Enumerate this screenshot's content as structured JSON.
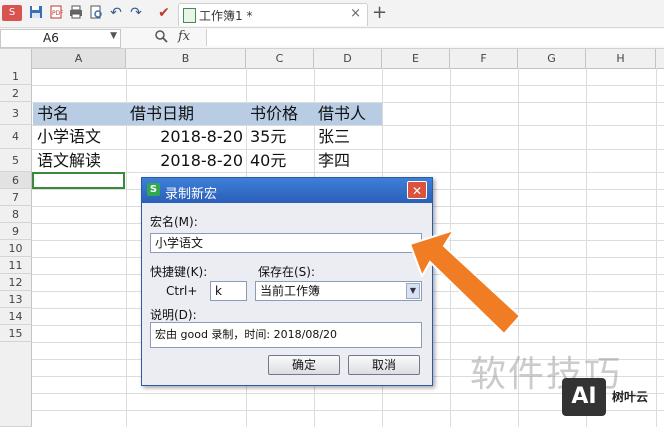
{
  "toolbar": {
    "app_menu_label": "S",
    "icons": [
      "folder-icon",
      "save-icon",
      "pdf-export-icon",
      "print-icon",
      "print-preview-icon",
      "undo-icon",
      "redo-icon",
      "format-painter-icon"
    ],
    "document_tab": {
      "title": "工作簿1 *",
      "close_label": "×"
    },
    "new_tab_label": "+"
  },
  "formula_bar": {
    "cell_reference": "A6",
    "fx_label": "fx",
    "formula_value": ""
  },
  "sheet": {
    "columns": [
      "A",
      "B",
      "C",
      "D",
      "E",
      "F",
      "G",
      "H"
    ],
    "rows": [
      "1",
      "2",
      "3",
      "4",
      "5",
      "6",
      "7",
      "8",
      "9",
      "10",
      "11",
      "12",
      "13",
      "14",
      "15"
    ],
    "header_row": [
      "书名",
      "借书日期",
      "书价格",
      "借书人"
    ],
    "data_rows": [
      [
        "小学语文",
        "2018-8-20",
        "35元",
        "张三"
      ],
      [
        "语文解读",
        "2018-8-20",
        "40元",
        "李四"
      ]
    ],
    "selected_cell": "A6",
    "header_fill_color": "#b8cce4"
  },
  "dialog": {
    "title": "录制新宏",
    "macro_name_label": "宏名(M):",
    "macro_name_value": "小学语文",
    "shortcut_label": "快捷键(K):",
    "ctrl_prefix": "Ctrl+",
    "shortcut_value": "k",
    "store_in_label": "保存在(S):",
    "store_in_value": "当前工作簿",
    "description_label": "说明(D):",
    "description_value": "宏由 good 录制，时间: 2018/08/20",
    "ok_label": "确定",
    "cancel_label": "取消",
    "close_label": "✕"
  },
  "watermark": {
    "text": "软件技巧",
    "logo_text": "AI",
    "brand": "树叶云"
  },
  "colors": {
    "accent_arrow": "#f07d24",
    "dialog_title_bar": "#2a5fb8",
    "selection_border": "#3b8a3b"
  }
}
